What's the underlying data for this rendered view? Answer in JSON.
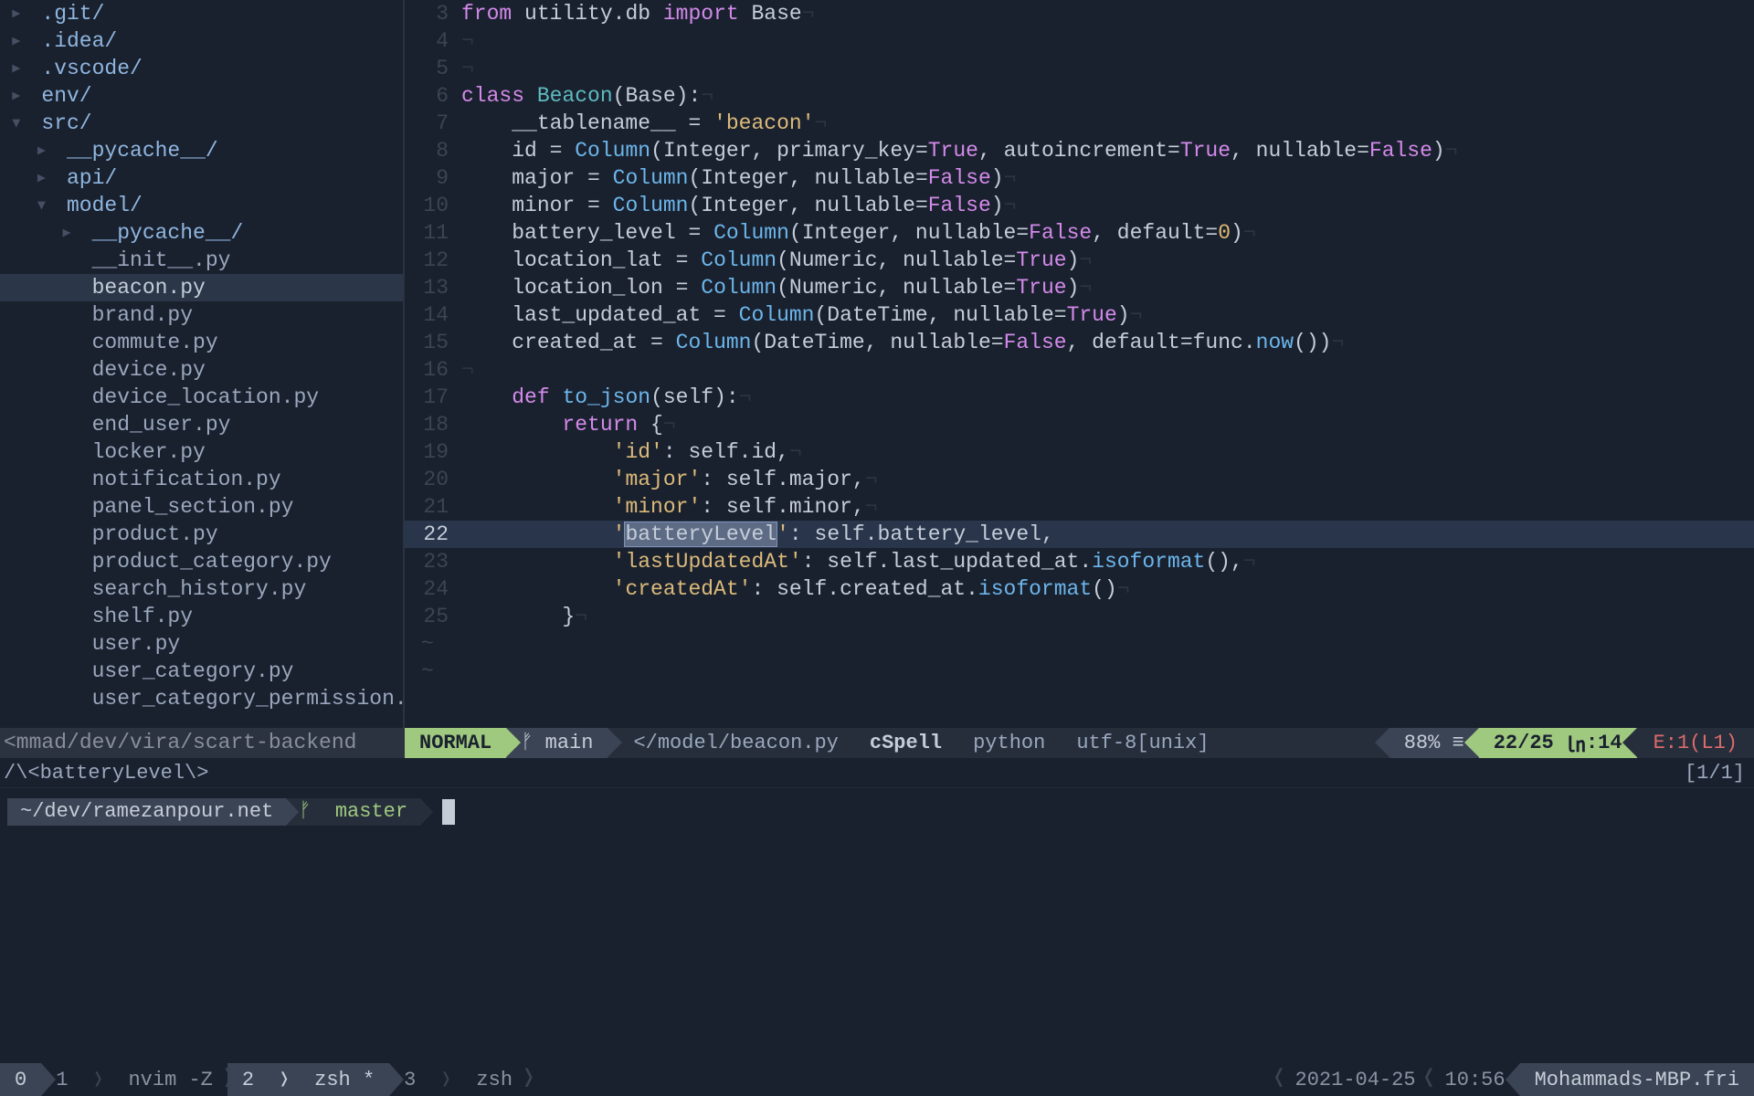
{
  "sidebar": {
    "tree": [
      {
        "depth": 0,
        "arrow": "▸",
        "label": ".git/",
        "kind": "dir"
      },
      {
        "depth": 0,
        "arrow": "▸",
        "label": ".idea/",
        "kind": "dir"
      },
      {
        "depth": 0,
        "arrow": "▸",
        "label": ".vscode/",
        "kind": "dir"
      },
      {
        "depth": 0,
        "arrow": "▸",
        "label": "env/",
        "kind": "dir"
      },
      {
        "depth": 0,
        "arrow": "▾",
        "label": "src/",
        "kind": "dir"
      },
      {
        "depth": 1,
        "arrow": "▸",
        "label": "__pycache__/",
        "kind": "dir"
      },
      {
        "depth": 1,
        "arrow": "▸",
        "label": "api/",
        "kind": "dir"
      },
      {
        "depth": 1,
        "arrow": "▾",
        "label": "model/",
        "kind": "dir"
      },
      {
        "depth": 2,
        "arrow": "▸",
        "label": "__pycache__/",
        "kind": "dir"
      },
      {
        "depth": 2,
        "arrow": " ",
        "label": "__init__.py",
        "kind": "file"
      },
      {
        "depth": 2,
        "arrow": " ",
        "label": "beacon.py",
        "kind": "file",
        "selected": true
      },
      {
        "depth": 2,
        "arrow": " ",
        "label": "brand.py",
        "kind": "file"
      },
      {
        "depth": 2,
        "arrow": " ",
        "label": "commute.py",
        "kind": "file"
      },
      {
        "depth": 2,
        "arrow": " ",
        "label": "device.py",
        "kind": "file"
      },
      {
        "depth": 2,
        "arrow": " ",
        "label": "device_location.py",
        "kind": "file"
      },
      {
        "depth": 2,
        "arrow": " ",
        "label": "end_user.py",
        "kind": "file"
      },
      {
        "depth": 2,
        "arrow": " ",
        "label": "locker.py",
        "kind": "file"
      },
      {
        "depth": 2,
        "arrow": " ",
        "label": "notification.py",
        "kind": "file"
      },
      {
        "depth": 2,
        "arrow": " ",
        "label": "panel_section.py",
        "kind": "file"
      },
      {
        "depth": 2,
        "arrow": " ",
        "label": "product.py",
        "kind": "file"
      },
      {
        "depth": 2,
        "arrow": " ",
        "label": "product_category.py",
        "kind": "file"
      },
      {
        "depth": 2,
        "arrow": " ",
        "label": "search_history.py",
        "kind": "file"
      },
      {
        "depth": 2,
        "arrow": " ",
        "label": "shelf.py",
        "kind": "file"
      },
      {
        "depth": 2,
        "arrow": " ",
        "label": "user.py",
        "kind": "file"
      },
      {
        "depth": 2,
        "arrow": " ",
        "label": "user_category.py",
        "kind": "file"
      },
      {
        "depth": 2,
        "arrow": " ",
        "label": "user_category_permission.",
        "kind": "file"
      }
    ],
    "status_path": "<mmad/dev/vira/scart-backend"
  },
  "editor": {
    "lines": [
      {
        "n": 3,
        "tokens": [
          [
            "kw",
            "from"
          ],
          [
            "op",
            " utility.db "
          ],
          [
            "kw",
            "import"
          ],
          [
            "op",
            " Base"
          ],
          [
            "ws",
            "¬"
          ]
        ]
      },
      {
        "n": 4,
        "tokens": [
          [
            "ws",
            "¬"
          ]
        ]
      },
      {
        "n": 5,
        "tokens": [
          [
            "ws",
            "¬"
          ]
        ]
      },
      {
        "n": 6,
        "tokens": [
          [
            "kw",
            "class"
          ],
          [
            "op",
            " "
          ],
          [
            "type",
            "Beacon"
          ],
          [
            "op",
            "(Base):"
          ],
          [
            "ws",
            "¬"
          ]
        ]
      },
      {
        "n": 7,
        "tokens": [
          [
            "op",
            "    __tablename__ "
          ],
          [
            "op",
            "="
          ],
          [
            "op",
            " "
          ],
          [
            "str",
            "'beacon'"
          ],
          [
            "ws",
            "¬"
          ]
        ]
      },
      {
        "n": 8,
        "tokens": [
          [
            "op",
            "    id "
          ],
          [
            "op",
            "="
          ],
          [
            "op",
            " "
          ],
          [
            "fn",
            "Column"
          ],
          [
            "op",
            "(Integer, primary_key"
          ],
          [
            "op",
            "="
          ],
          [
            "bool",
            "True"
          ],
          [
            "op",
            ", autoincrement"
          ],
          [
            "op",
            "="
          ],
          [
            "bool",
            "True"
          ],
          [
            "op",
            ", nullable"
          ],
          [
            "op",
            "="
          ],
          [
            "bool",
            "False"
          ],
          [
            "op",
            ")"
          ],
          [
            "ws",
            "¬"
          ]
        ]
      },
      {
        "n": 9,
        "tokens": [
          [
            "op",
            "    major "
          ],
          [
            "op",
            "="
          ],
          [
            "op",
            " "
          ],
          [
            "fn",
            "Column"
          ],
          [
            "op",
            "(Integer, nullable"
          ],
          [
            "op",
            "="
          ],
          [
            "bool",
            "False"
          ],
          [
            "op",
            ")"
          ],
          [
            "ws",
            "¬"
          ]
        ]
      },
      {
        "n": 10,
        "tokens": [
          [
            "op",
            "    minor "
          ],
          [
            "op",
            "="
          ],
          [
            "op",
            " "
          ],
          [
            "fn",
            "Column"
          ],
          [
            "op",
            "(Integer, nullable"
          ],
          [
            "op",
            "="
          ],
          [
            "bool",
            "False"
          ],
          [
            "op",
            ")"
          ],
          [
            "ws",
            "¬"
          ]
        ]
      },
      {
        "n": 11,
        "tokens": [
          [
            "op",
            "    battery_level "
          ],
          [
            "op",
            "="
          ],
          [
            "op",
            " "
          ],
          [
            "fn",
            "Column"
          ],
          [
            "op",
            "(Integer, nullable"
          ],
          [
            "op",
            "="
          ],
          [
            "bool",
            "False"
          ],
          [
            "op",
            ", default"
          ],
          [
            "op",
            "="
          ],
          [
            "num",
            "0"
          ],
          [
            "op",
            ")"
          ],
          [
            "ws",
            "¬"
          ]
        ]
      },
      {
        "n": 12,
        "tokens": [
          [
            "op",
            "    location_lat "
          ],
          [
            "op",
            "="
          ],
          [
            "op",
            " "
          ],
          [
            "fn",
            "Column"
          ],
          [
            "op",
            "(Numeric, nullable"
          ],
          [
            "op",
            "="
          ],
          [
            "bool",
            "True"
          ],
          [
            "op",
            ")"
          ],
          [
            "ws",
            "¬"
          ]
        ]
      },
      {
        "n": 13,
        "tokens": [
          [
            "op",
            "    location_lon "
          ],
          [
            "op",
            "="
          ],
          [
            "op",
            " "
          ],
          [
            "fn",
            "Column"
          ],
          [
            "op",
            "(Numeric, nullable"
          ],
          [
            "op",
            "="
          ],
          [
            "bool",
            "True"
          ],
          [
            "op",
            ")"
          ],
          [
            "ws",
            "¬"
          ]
        ]
      },
      {
        "n": 14,
        "tokens": [
          [
            "op",
            "    last_updated_at "
          ],
          [
            "op",
            "="
          ],
          [
            "op",
            " "
          ],
          [
            "fn",
            "Column"
          ],
          [
            "op",
            "(DateTime, nullable"
          ],
          [
            "op",
            "="
          ],
          [
            "bool",
            "True"
          ],
          [
            "op",
            ")"
          ],
          [
            "ws",
            "¬"
          ]
        ]
      },
      {
        "n": 15,
        "tokens": [
          [
            "op",
            "    created_at "
          ],
          [
            "op",
            "="
          ],
          [
            "op",
            " "
          ],
          [
            "fn",
            "Column"
          ],
          [
            "op",
            "(DateTime, nullable"
          ],
          [
            "op",
            "="
          ],
          [
            "bool",
            "False"
          ],
          [
            "op",
            ", default"
          ],
          [
            "op",
            "="
          ],
          [
            "op",
            "func."
          ],
          [
            "fn",
            "now"
          ],
          [
            "op",
            "())"
          ],
          [
            "ws",
            "¬"
          ]
        ]
      },
      {
        "n": 16,
        "tokens": [
          [
            "ws",
            "¬"
          ]
        ]
      },
      {
        "n": 17,
        "tokens": [
          [
            "op",
            "    "
          ],
          [
            "kw",
            "def"
          ],
          [
            "op",
            " "
          ],
          [
            "fn",
            "to_json"
          ],
          [
            "op",
            "(self):"
          ],
          [
            "ws",
            "¬"
          ]
        ]
      },
      {
        "n": 18,
        "tokens": [
          [
            "op",
            "        "
          ],
          [
            "kw",
            "return"
          ],
          [
            "op",
            " {"
          ],
          [
            "ws",
            "¬"
          ]
        ]
      },
      {
        "n": 19,
        "tokens": [
          [
            "op",
            "            "
          ],
          [
            "str",
            "'id'"
          ],
          [
            "op",
            ": self.id,"
          ],
          [
            "ws",
            "¬"
          ]
        ]
      },
      {
        "n": 20,
        "tokens": [
          [
            "op",
            "            "
          ],
          [
            "str",
            "'major'"
          ],
          [
            "op",
            ": self.major,"
          ],
          [
            "ws",
            "¬"
          ]
        ]
      },
      {
        "n": 21,
        "tokens": [
          [
            "op",
            "            "
          ],
          [
            "str",
            "'minor'"
          ],
          [
            "op",
            ": self.minor,"
          ],
          [
            "ws",
            "¬"
          ]
        ]
      },
      {
        "n": 22,
        "cursor": true,
        "tokens": [
          [
            "op",
            "            "
          ],
          [
            "str",
            "'"
          ],
          [
            "search",
            "batteryLevel"
          ],
          [
            "str",
            "'"
          ],
          [
            "op",
            ": self.battery_level,"
          ]
        ]
      },
      {
        "n": 23,
        "tokens": [
          [
            "op",
            "            "
          ],
          [
            "str",
            "'lastUpdatedAt'"
          ],
          [
            "op",
            ": self.last_updated_at."
          ],
          [
            "fn",
            "isoformat"
          ],
          [
            "op",
            "(),"
          ],
          [
            "ws",
            "¬"
          ]
        ]
      },
      {
        "n": 24,
        "tokens": [
          [
            "op",
            "            "
          ],
          [
            "str",
            "'createdAt'"
          ],
          [
            "op",
            ": self.created_at."
          ],
          [
            "fn",
            "isoformat"
          ],
          [
            "op",
            "()"
          ],
          [
            "ws",
            "¬"
          ]
        ]
      },
      {
        "n": 25,
        "tokens": [
          [
            "op",
            "        }"
          ],
          [
            "ws",
            "¬"
          ]
        ]
      }
    ]
  },
  "statusline": {
    "mode": "NORMAL",
    "branch_icon": "ᚠ",
    "branch": "main",
    "path": "</model/beacon.py",
    "spell": "cSpell",
    "ft": "python",
    "enc": "utf-8[unix]",
    "pct": "88%",
    "lines_icon": "≡",
    "pos_line": "22/25",
    "pos_sep": "㏑",
    "pos_col": ":14",
    "err": "E:1(L1)"
  },
  "search": {
    "pattern": "/\\<batteryLevel\\>",
    "count": "[1/1]"
  },
  "terminal": {
    "path": "~/dev/ramezanpour.net",
    "branch_icon": "ᚠ",
    "branch": "master"
  },
  "tmux": {
    "session": "0",
    "windows": [
      {
        "idx": "1",
        "name": "nvim -Z",
        "active": false
      },
      {
        "idx": "2",
        "name": "zsh *",
        "active": true
      },
      {
        "idx": "3",
        "name": "zsh",
        "active": false
      }
    ],
    "date": "2021-04-25",
    "time": "10:56",
    "host": "Mohammads-MBP.fri"
  }
}
